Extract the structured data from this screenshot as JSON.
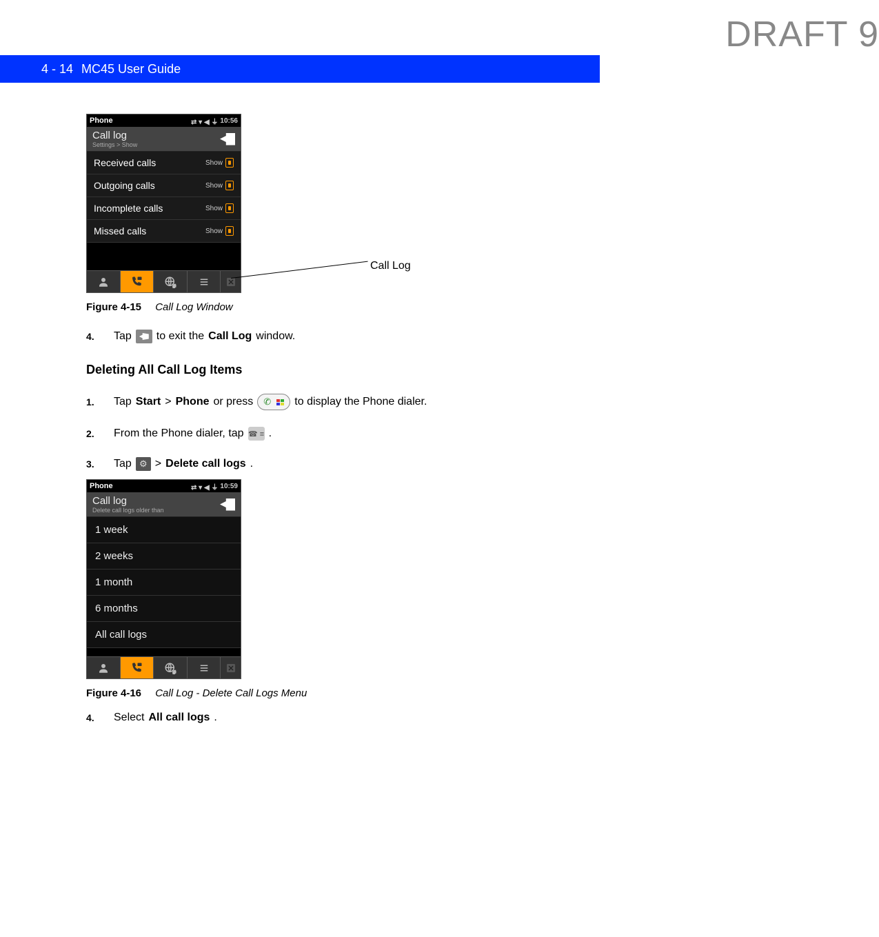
{
  "watermark": "DRAFT 9",
  "header": {
    "page_num": "4 - 14",
    "guide_title": "MC45 User Guide"
  },
  "figure1": {
    "status_title": "Phone",
    "status_time": "10:56",
    "header_title": "Call log",
    "header_sub": "Settings > Show",
    "rows": [
      {
        "label": "Received calls",
        "badge": "Show"
      },
      {
        "label": "Outgoing calls",
        "badge": "Show"
      },
      {
        "label": "Incomplete calls",
        "badge": "Show"
      },
      {
        "label": "Missed calls",
        "badge": "Show"
      }
    ],
    "callout": "Call Log"
  },
  "caption1": {
    "num": "Figure 4-15",
    "title": "Call Log Window"
  },
  "step4a": {
    "num": "4.",
    "before": "Tap",
    "after1": "to exit the",
    "bold": "Call Log",
    "after2": "window."
  },
  "subheading": "Deleting All Call Log Items",
  "step1": {
    "num": "1.",
    "t1": "Tap",
    "b1": "Start",
    "gt": ">",
    "b2": "Phone",
    "t2": "or press",
    "t3": "to display the Phone dialer."
  },
  "step2": {
    "num": "2.",
    "t1": "From the Phone dialer, tap",
    "t2": "."
  },
  "step3": {
    "num": "3.",
    "t1": "Tap",
    "gt": ">",
    "b1": "Delete call logs",
    "t2": "."
  },
  "figure2": {
    "status_title": "Phone",
    "status_time": "10:59",
    "header_title": "Call log",
    "header_sub": "Delete call logs older than",
    "rows": [
      "1 week",
      "2 weeks",
      "1 month",
      "6 months",
      "All call logs"
    ]
  },
  "caption2": {
    "num": "Figure 4-16",
    "title": "Call Log - Delete Call Logs Menu"
  },
  "step4b": {
    "num": "4.",
    "t1": "Select",
    "b1": "All call logs",
    "t2": "."
  }
}
